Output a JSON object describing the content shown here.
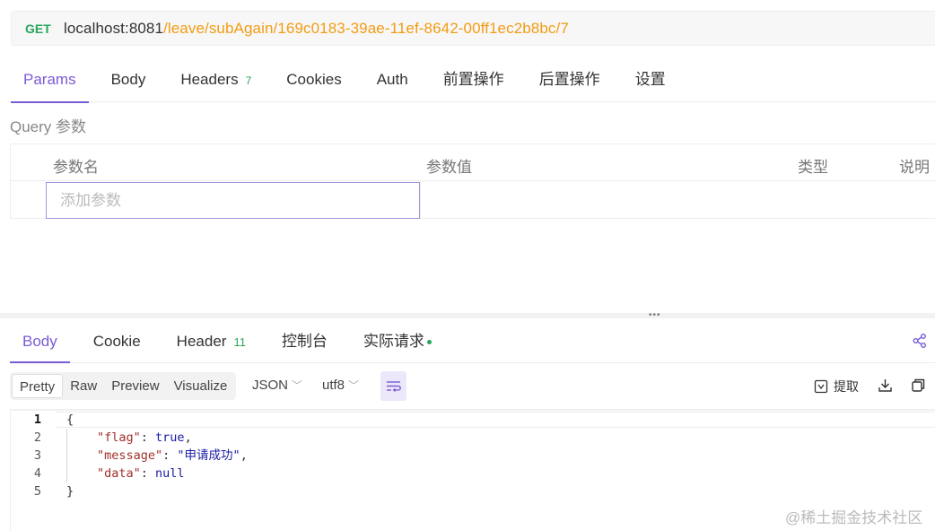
{
  "request": {
    "method": "GET",
    "url_host": "localhost:8081",
    "url_path": "/leave/subAgain/169c0183-39ae-11ef-8642-00ff1ec2b8bc/7"
  },
  "request_tabs": [
    {
      "label": "Params",
      "badge": ""
    },
    {
      "label": "Body",
      "badge": ""
    },
    {
      "label": "Headers",
      "badge": "7"
    },
    {
      "label": "Cookies",
      "badge": ""
    },
    {
      "label": "Auth",
      "badge": ""
    },
    {
      "label": "前置操作",
      "badge": ""
    },
    {
      "label": "后置操作",
      "badge": ""
    },
    {
      "label": "设置",
      "badge": ""
    }
  ],
  "query": {
    "label": "Query 参数",
    "columns": [
      "参数名",
      "参数值",
      "类型",
      "说明"
    ],
    "add_placeholder": "添加参数"
  },
  "response_tabs": [
    {
      "label": "Body",
      "badge": ""
    },
    {
      "label": "Cookie",
      "badge": ""
    },
    {
      "label": "Header",
      "badge": "11"
    },
    {
      "label": "控制台",
      "badge": ""
    },
    {
      "label": "实际请求",
      "badge": ""
    }
  ],
  "response_toolbar": {
    "formats": [
      "Pretty",
      "Raw",
      "Preview",
      "Visualize"
    ],
    "type_select": "JSON",
    "encoding_select": "utf8",
    "extract_label": "提取"
  },
  "code_lines": [
    {
      "n": "1",
      "text": "{"
    },
    {
      "n": "2",
      "key": "\"flag\"",
      "sep": ": ",
      "value": "true",
      "end": ","
    },
    {
      "n": "3",
      "key": "\"message\"",
      "sep": ": ",
      "value": "\"申请成功\"",
      "end": ","
    },
    {
      "n": "4",
      "key": "\"data\"",
      "sep": ": ",
      "value": "null",
      "end": ""
    },
    {
      "n": "5",
      "text": "}"
    }
  ],
  "watermark": "@稀土掘金技术社区",
  "colors": {
    "accent": "#7a5bd6",
    "method_get": "#26a65b",
    "url_path": "#f39c12"
  }
}
